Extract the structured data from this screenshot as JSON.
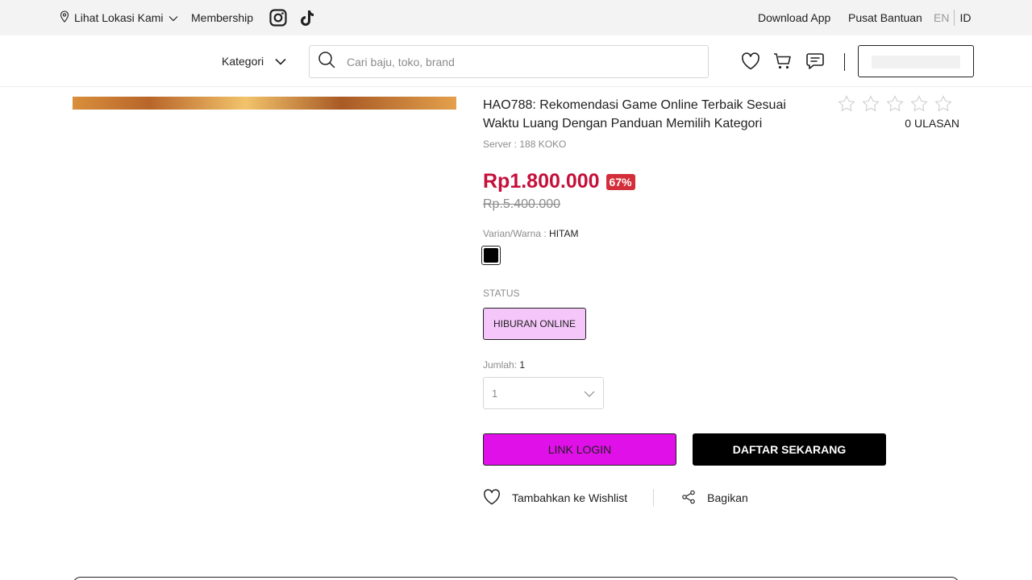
{
  "topbar": {
    "location": "Lihat Lokasi Kami",
    "membership": "Membership",
    "download_app": "Download App",
    "help": "Pusat Bantuan",
    "lang_en": "EN",
    "lang_id": "ID"
  },
  "header": {
    "kategori": "Kategori",
    "search_placeholder": "Cari baju, toko, brand"
  },
  "product": {
    "title": "HAO788: Rekomendasi Game Online Terbaik Sesuai Waktu Luang Dengan Panduan Memilih Kategori",
    "rating": 0,
    "reviews": "0 ULASAN",
    "server": "Server : 188 KOKO",
    "price": "Rp1.800.000",
    "discount": "67%",
    "old_price": "Rp.5.400.000",
    "variant_label": "Varian/Warna : ",
    "variant_value": "HITAM",
    "variant_color": "#000000",
    "status_label": "STATUS",
    "status_value": "HIBURAN ONLINE",
    "qty_label": "Jumlah: ",
    "qty_value": "1",
    "qty_selected": "1"
  },
  "buttons": {
    "login": "LINK LOGIN",
    "register": "DAFTAR SEKARANG"
  },
  "actions": {
    "wishlist": "Tambahkan ke Wishlist",
    "share": "Bagikan"
  },
  "colors": {
    "price": "#c4103b",
    "discount_badge": "#d32f3a",
    "login_button": "#e010e8",
    "status_chip": "#f4c6f9"
  }
}
